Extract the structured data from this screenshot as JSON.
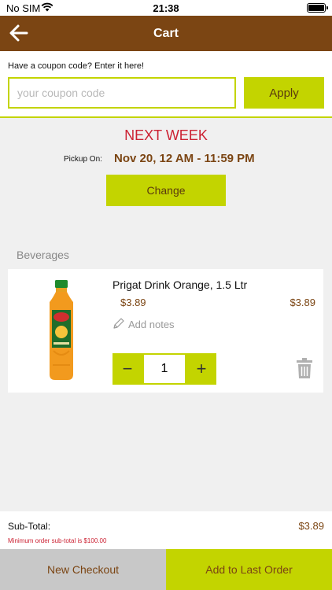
{
  "status_bar": {
    "carrier": "No SIM",
    "time": "21:38"
  },
  "navbar": {
    "title": "Cart"
  },
  "coupon": {
    "prompt": "Have a coupon code? Enter it here!",
    "placeholder": "your coupon code",
    "value": "",
    "apply_label": "Apply"
  },
  "pickup": {
    "week": "NEXT WEEK",
    "label": "Pickup On:",
    "date": "Nov 20, 12 AM - 11:59 PM",
    "change_label": "Change"
  },
  "section": {
    "title": "Beverages"
  },
  "item": {
    "name": "Prigat Drink Orange, 1.5 Ltr",
    "unit_price": "$3.89",
    "line_total": "$3.89",
    "notes_label": "Add notes",
    "quantity": "1",
    "minus": "−",
    "plus": "+"
  },
  "summary": {
    "label": "Sub-Total:",
    "value": "$3.89",
    "minimum_note": "Minimum order sub-total is $100.00"
  },
  "footer": {
    "new_checkout": "New Checkout",
    "add_last": "Add to Last Order"
  },
  "colors": {
    "brand_brown": "#7b4513",
    "accent_green": "#c3d400",
    "alert_red": "#cc2233"
  }
}
